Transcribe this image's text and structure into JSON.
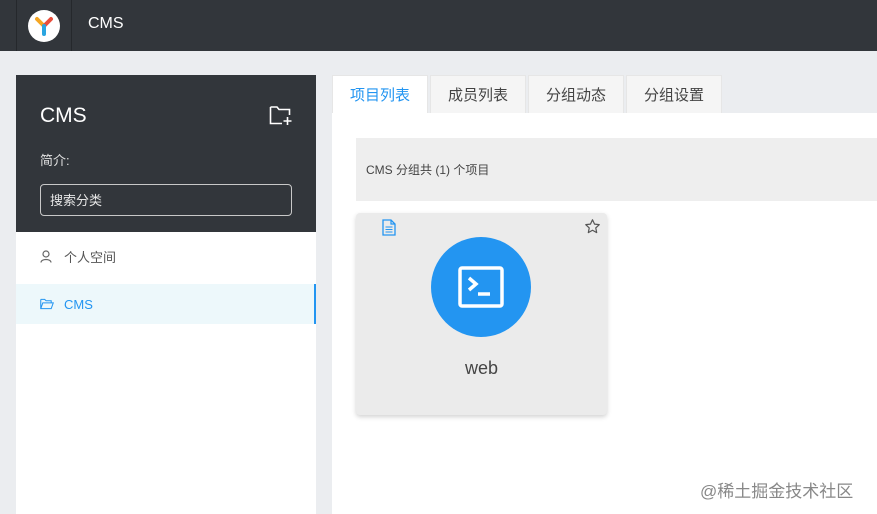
{
  "header": {
    "app_title": "CMS",
    "logo_icon": "yapi-logo-icon"
  },
  "sidebar": {
    "group_title": "CMS",
    "add_group_icon": "folder-add-icon",
    "intro_label": "简介:",
    "search_placeholder": "搜索分类",
    "items": [
      {
        "label": "个人空间",
        "icon": "user-icon",
        "active": false
      },
      {
        "label": "CMS",
        "icon": "folder-open-icon",
        "active": true
      }
    ]
  },
  "tabs": [
    {
      "label": "项目列表",
      "active": true
    },
    {
      "label": "成员列表",
      "active": false
    },
    {
      "label": "分组动态",
      "active": false
    },
    {
      "label": "分组设置",
      "active": false
    }
  ],
  "main": {
    "summary": "CMS 分组共 (1) 个项目",
    "projects": [
      {
        "name": "web",
        "icon": "terminal-icon",
        "color": "#2395f1",
        "starred": false
      }
    ]
  },
  "watermark": "@稀土掘金技术社区",
  "colors": {
    "topbar": "#32363b",
    "accent": "#2395f1",
    "active_item_bg": "#edf8fb"
  }
}
